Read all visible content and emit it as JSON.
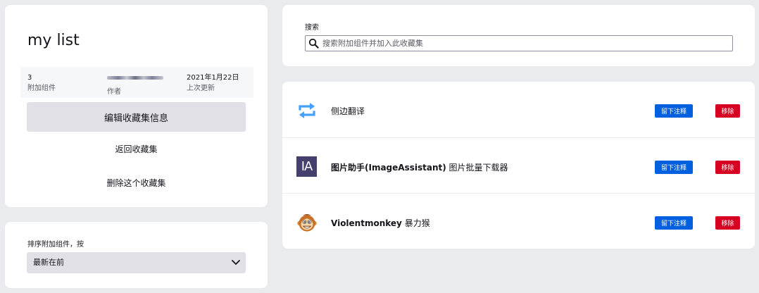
{
  "collection": {
    "title": "my list",
    "addons_count": "3",
    "addons_label": "附加组件",
    "author_label": "作者",
    "updated_value": "2021年1月22日",
    "updated_label": "上次更新",
    "edit_button": "编辑收藏集信息",
    "back_link": "返回收藏集",
    "delete_link": "删除这个收藏集"
  },
  "sort": {
    "label": "排序附加组件，按",
    "selected": "最新在前"
  },
  "search": {
    "label": "搜索",
    "placeholder": "搜索附加组件并加入此收藏集"
  },
  "addons": [
    {
      "name": "侧边翻译",
      "icon": "swap-arrows-icon",
      "note_button": "留下注释",
      "remove_button": "移除"
    },
    {
      "name_bold": "图片助手(ImageAssistant)",
      "name_rest": " 图片批量下载器",
      "icon": "ia-logo",
      "icon_text": "IA",
      "note_button": "留下注释",
      "remove_button": "移除"
    },
    {
      "name_bold": "Violentmonkey",
      "name_rest": " 暴力猴",
      "icon": "monkey-icon",
      "note_button": "留下注释",
      "remove_button": "移除"
    }
  ],
  "colors": {
    "page_bg": "#eaebef",
    "primary_button": "#0060df",
    "danger_button": "#d70022",
    "secondary_button": "#e0e0e6",
    "ia_logo_bg": "#43406e",
    "swap_icon": "#45a1ff"
  }
}
